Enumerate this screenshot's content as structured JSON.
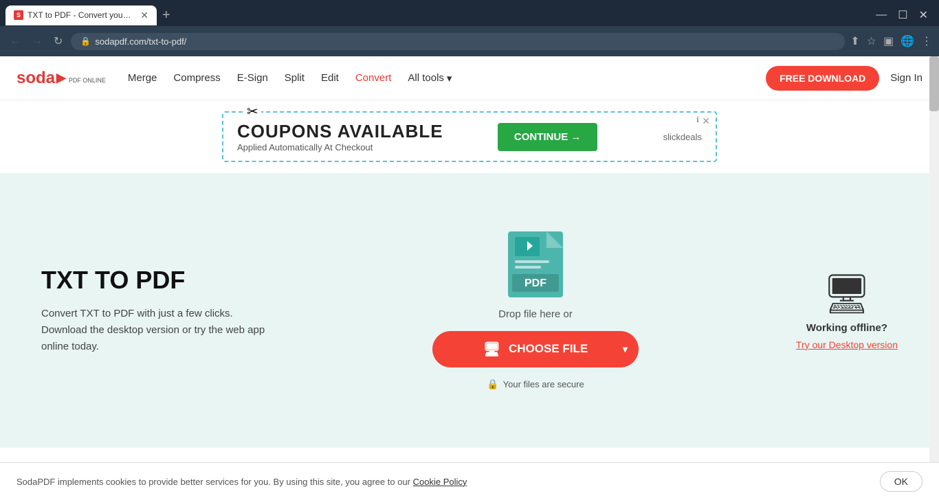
{
  "browser": {
    "tab_favicon": "S",
    "tab_title": "TXT to PDF - Convert your TXT t...",
    "url": "sodapdf.com/txt-to-pdf/",
    "new_tab_label": "+",
    "nav_back": "←",
    "nav_forward": "→",
    "nav_refresh": "↻"
  },
  "header": {
    "logo_text": "soda",
    "logo_arrow": "▶",
    "logo_sub": "PDF ONLINE",
    "nav_items": [
      {
        "label": "Merge",
        "id": "merge"
      },
      {
        "label": "Compress",
        "id": "compress"
      },
      {
        "label": "E-Sign",
        "id": "esign"
      },
      {
        "label": "Split",
        "id": "split"
      },
      {
        "label": "Edit",
        "id": "edit"
      },
      {
        "label": "Convert",
        "id": "convert"
      },
      {
        "label": "All tools",
        "id": "alltools"
      }
    ],
    "free_download_label": "FREE DOWNLOAD",
    "sign_in_label": "Sign In"
  },
  "ad": {
    "scissors": "✂",
    "title": "COUPONS AVAILABLE",
    "subtitle": "Applied Automatically At Checkout",
    "continue_label": "CONTINUE →",
    "slickdeals_label": "slickdeals",
    "info_icon": "ℹ",
    "close_icon": "✕"
  },
  "main": {
    "heading": "TXT TO PDF",
    "description": "Convert TXT to PDF with just a few clicks. Download the desktop version or try the web app online today.",
    "drop_text": "Drop file here or",
    "choose_file_label": "CHOOSE FILE",
    "dropdown_icon": "▾",
    "secure_text": "Your files are secure",
    "offline_heading": "Working offline?",
    "desktop_link": "Try our Desktop version"
  },
  "cookie": {
    "text": "SodaPDF implements cookies to provide better services for you. By using this site, you agree to our",
    "link_text": "Cookie Policy",
    "ok_label": "OK"
  }
}
